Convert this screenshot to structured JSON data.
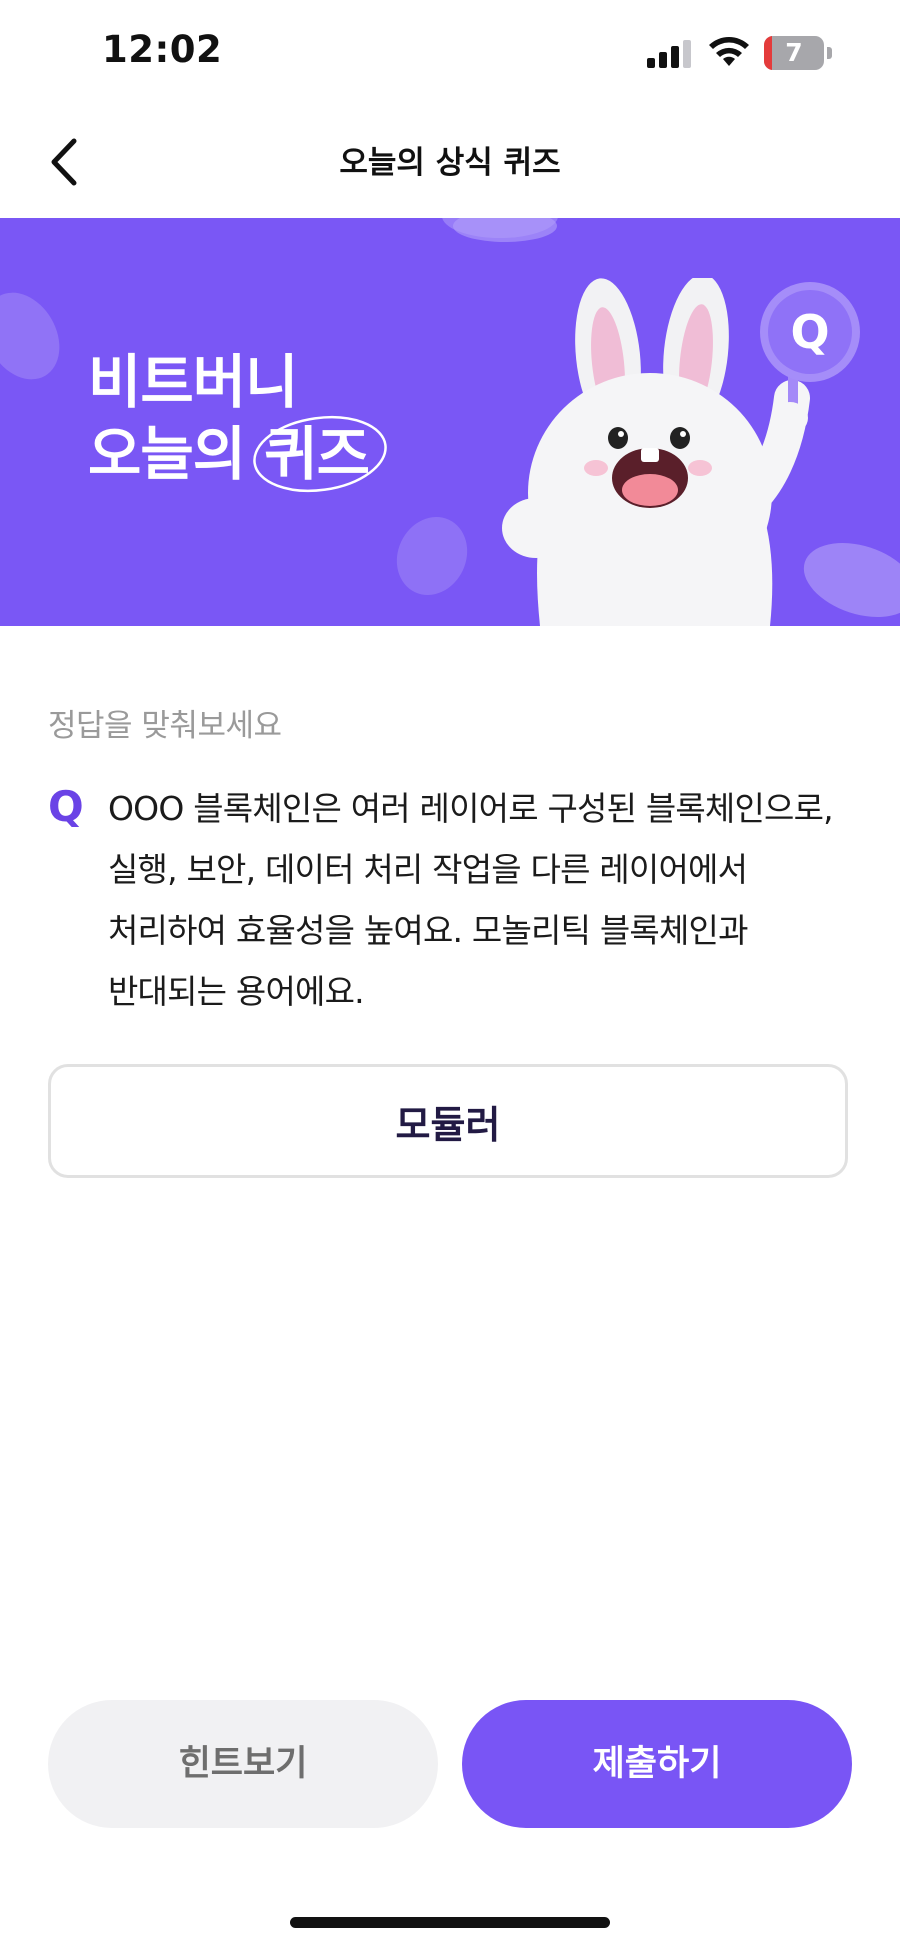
{
  "status_bar": {
    "time": "12:02",
    "battery_level": "7",
    "icons": [
      "signal-icon",
      "wifi-icon",
      "battery-icon"
    ]
  },
  "nav": {
    "title": "오늘의 상식 퀴즈",
    "back_icon": "chevron-left-icon"
  },
  "banner": {
    "title_line1": "비트버니",
    "title_line2_prefix": "오늘의 ",
    "title_line2_highlight": "퀴즈",
    "badge_letter": "Q",
    "background_color": "#7a57f5"
  },
  "quiz": {
    "instruction": "정답을 맞춰보세요",
    "q_mark": "Q",
    "question": "OOO 블록체인은 여러 레이어로 구성된 블록체인으로, 실행, 보안, 데이터 처리 작업을 다른 레이어에서 처리하여 효율성을 높여요. 모놀리틱 블록체인과 반대되는 용어에요.",
    "answer_value": "모듈러"
  },
  "buttons": {
    "hint_label": "힌트보기",
    "submit_label": "제출하기"
  },
  "colors": {
    "accent": "#7955f5",
    "q_mark": "#6a43e6",
    "hint_bg": "#f1f1f3"
  }
}
